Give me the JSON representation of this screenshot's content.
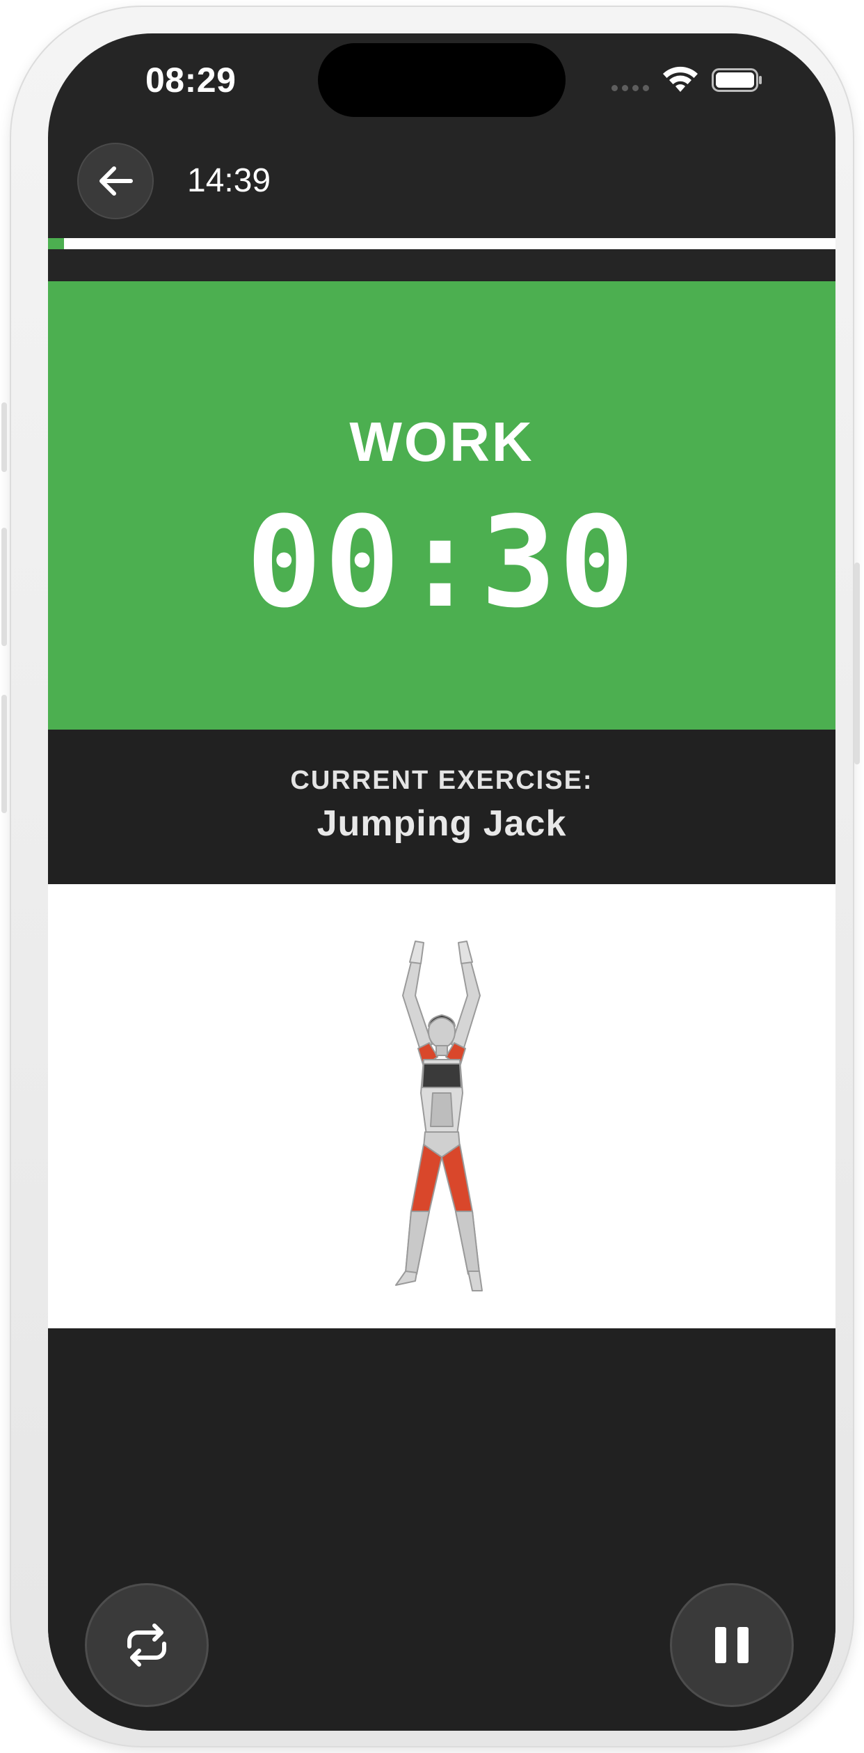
{
  "status_bar": {
    "time": "08:29"
  },
  "header": {
    "back_icon": "arrow-left-icon",
    "elapsed_time": "14:39"
  },
  "progress": {
    "fraction": 0.02,
    "fill_color": "#4caf50",
    "track_color": "#ffffff"
  },
  "phase": {
    "label": "WORK",
    "timer": "00:30",
    "color": "#4caf50"
  },
  "exercise": {
    "caption": "CURRENT EXERCISE:",
    "name": "Jumping Jack"
  },
  "controls": {
    "repeat_icon": "repeat-icon",
    "pause_icon": "pause-icon"
  },
  "colors": {
    "background": "#252525",
    "panel_dark": "#212121",
    "muscle_highlight": "#d9472b"
  }
}
